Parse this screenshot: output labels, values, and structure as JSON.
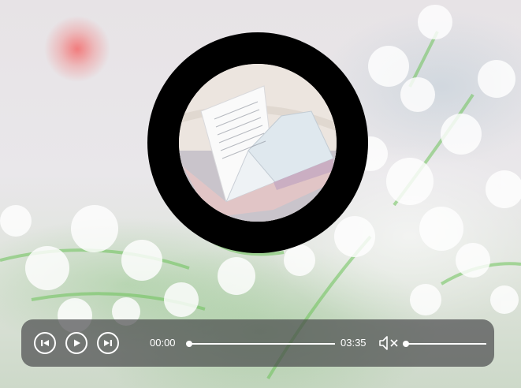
{
  "player": {
    "current_time": "00:00",
    "duration": "03:35",
    "progress": 0,
    "volume": 0,
    "muted": true,
    "controls": [
      "previous-icon",
      "play-icon",
      "next-icon",
      "volume-muted-icon"
    ]
  },
  "cover": {
    "icon": "open-book-image"
  },
  "colors": {
    "disc": "#000000",
    "control_bar": "rgba(70,70,72,0.68)",
    "control_fg": "#ffffff"
  }
}
